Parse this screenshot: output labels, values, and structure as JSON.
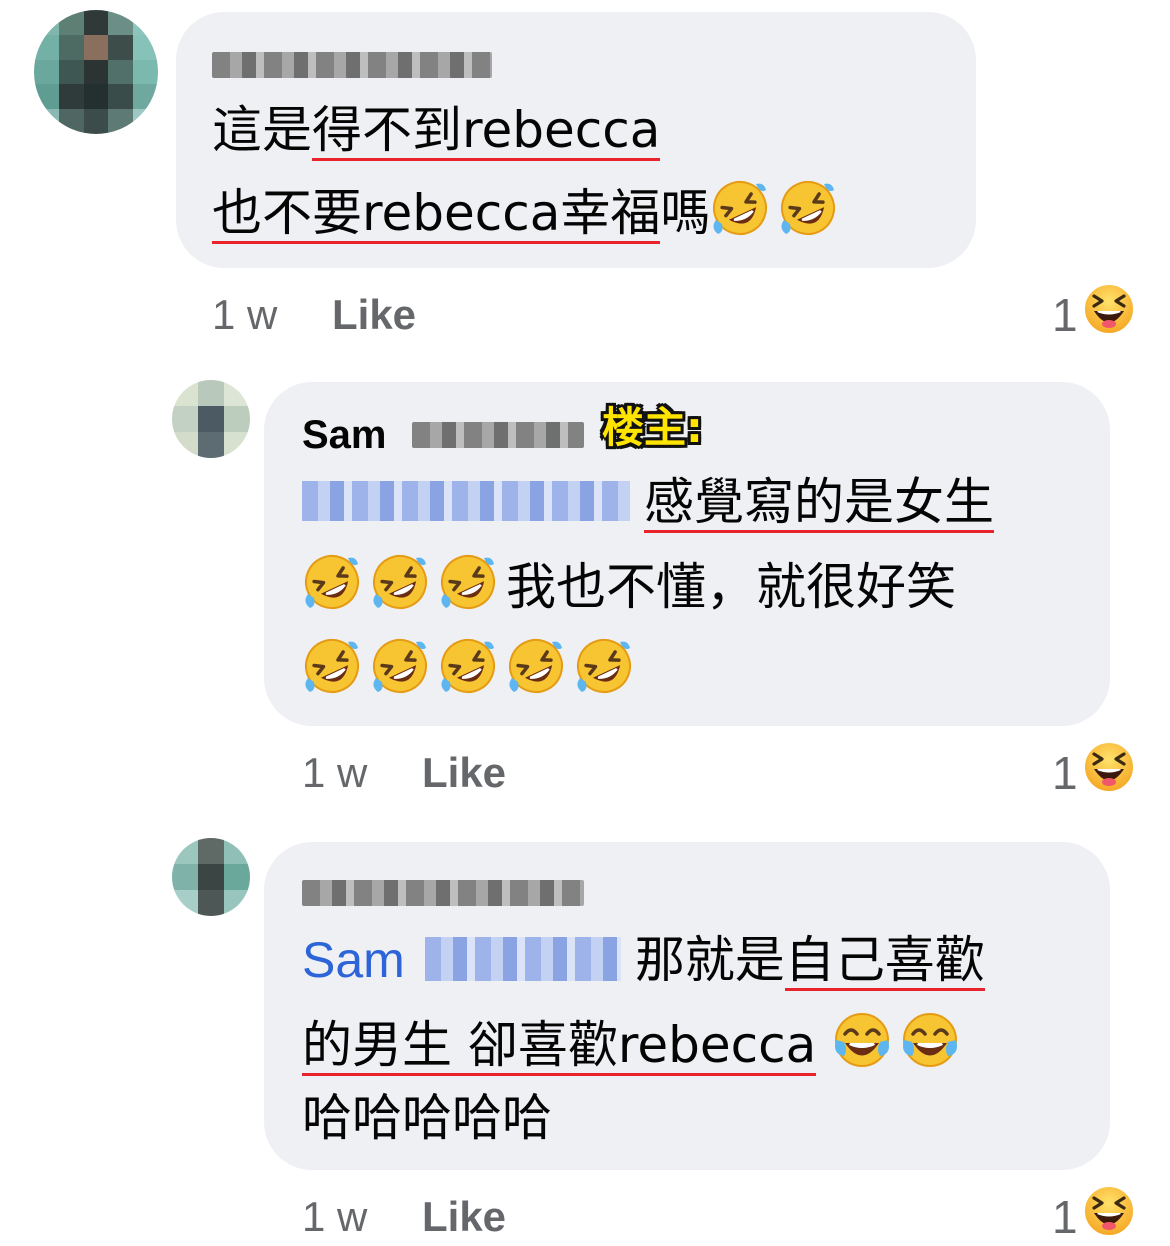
{
  "comments": [
    {
      "id": "c1",
      "author": "",
      "is_op": false,
      "lines": [
        {
          "segments": [
            {
              "text": "這是",
              "underline": false
            },
            {
              "text": "得不到rebecca",
              "underline": true
            }
          ]
        },
        {
          "segments": [
            {
              "text": "也不要rebecca幸福",
              "underline": true
            },
            {
              "text": "嗎",
              "underline": false
            }
          ],
          "emoji": [
            "rofl",
            "rofl"
          ]
        }
      ],
      "time": "1 w",
      "like_label": "Like",
      "reaction_count": "1",
      "reaction_icon": "laughing-reaction-icon"
    },
    {
      "id": "c2",
      "author": "Sam",
      "op_label": "楼主:",
      "is_op": true,
      "lines": [
        {
          "segments": [
            {
              "text": "感覺寫的是女生",
              "underline": true
            }
          ]
        },
        {
          "pre_emoji": [
            "rofl",
            "rofl",
            "rofl"
          ],
          "segments": [
            {
              "text": "我也不懂，就很好笑",
              "underline": false
            }
          ]
        },
        {
          "pre_emoji": [
            "rofl",
            "rofl",
            "rofl",
            "rofl",
            "rofl"
          ],
          "segments": []
        }
      ],
      "time": "1 w",
      "like_label": "Like",
      "reaction_count": "1",
      "reaction_icon": "laughing-reaction-icon"
    },
    {
      "id": "c3",
      "author": "",
      "is_op": false,
      "mention": "Sam",
      "lines": [
        {
          "segments": [
            {
              "text": "那就是",
              "underline": false
            },
            {
              "text": "自己喜歡",
              "underline": true
            }
          ]
        },
        {
          "segments": [
            {
              "text": "的男生 卻喜歡rebecca",
              "underline": true
            }
          ],
          "emoji": [
            "joy",
            "joy"
          ]
        },
        {
          "segments": [
            {
              "text": "哈哈哈哈哈",
              "underline": false
            }
          ]
        }
      ],
      "time": "1 w",
      "like_label": "Like",
      "reaction_count": "1",
      "reaction_icon": "laughing-reaction-icon"
    }
  ],
  "colors": {
    "bubble": "#eff0f3",
    "underline": "#e8232c",
    "mention": "#2d64d8",
    "meta": "#65676b",
    "op_label": "#ffe400"
  }
}
